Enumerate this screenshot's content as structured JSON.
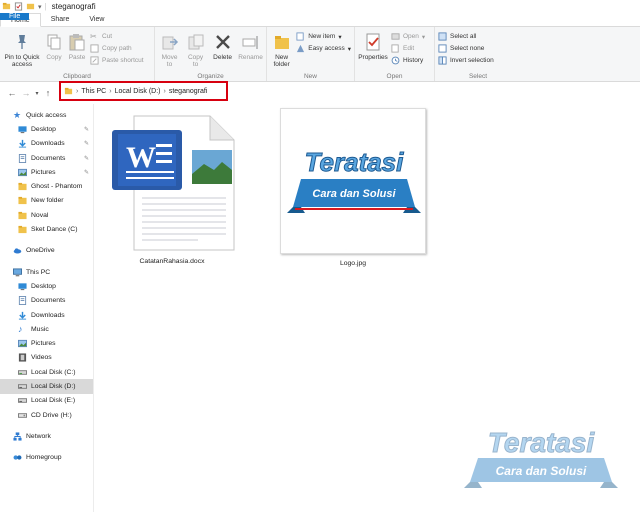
{
  "window": {
    "title": "steganografi"
  },
  "tabs": [
    "File",
    "Home",
    "Share",
    "View"
  ],
  "ribbon": {
    "clipboard": {
      "label": "Clipboard",
      "pin": "Pin to Quick\naccess",
      "copy": "Copy",
      "paste": "Paste",
      "cut": "Cut",
      "copy_path": "Copy path",
      "paste_shortcut": "Paste shortcut"
    },
    "organize": {
      "label": "Organize",
      "move_to": "Move\nto",
      "copy_to": "Copy\nto",
      "delete": "Delete",
      "rename": "Rename"
    },
    "new": {
      "label": "New",
      "new_folder": "New\nfolder",
      "new_item": "New item",
      "easy_access": "Easy access"
    },
    "open": {
      "label": "Open",
      "properties": "Properties",
      "open": "Open",
      "edit": "Edit",
      "history": "History"
    },
    "select": {
      "label": "Select",
      "select_all": "Select all",
      "select_none": "Select none",
      "invert": "Invert selection"
    }
  },
  "address": {
    "crumbs": [
      "This PC",
      "Local Disk (D:)",
      "steganografi"
    ]
  },
  "sidebar": {
    "quick_access": "Quick access",
    "quick_items": [
      "Desktop",
      "Downloads",
      "Documents",
      "Pictures",
      "Ghost - Phantom",
      "New folder",
      "Noval",
      "Sket Dance (C)"
    ],
    "onedrive": "OneDrive",
    "this_pc": "This PC",
    "pc_items": [
      "Desktop",
      "Documents",
      "Downloads",
      "Music",
      "Pictures",
      "Videos",
      "Local Disk (C:)",
      "Local Disk (D:)",
      "Local Disk (E:)",
      "CD Drive (H:)"
    ],
    "network": "Network",
    "homegroup": "Homegroup"
  },
  "files": [
    {
      "name": "CatatanRahasia.docx",
      "icon": "word-document-icon"
    },
    {
      "name": "Logo.jpg",
      "icon": "image-thumbnail-icon"
    }
  ],
  "logo_text": {
    "main": "Teratasi",
    "sub": "Cara dan Solusi"
  },
  "colors": {
    "file_tab": "#1979ca",
    "highlight_box": "#d7000f",
    "selected_item": "#d9d9d9",
    "logo_blue": "#1a6fb0"
  }
}
